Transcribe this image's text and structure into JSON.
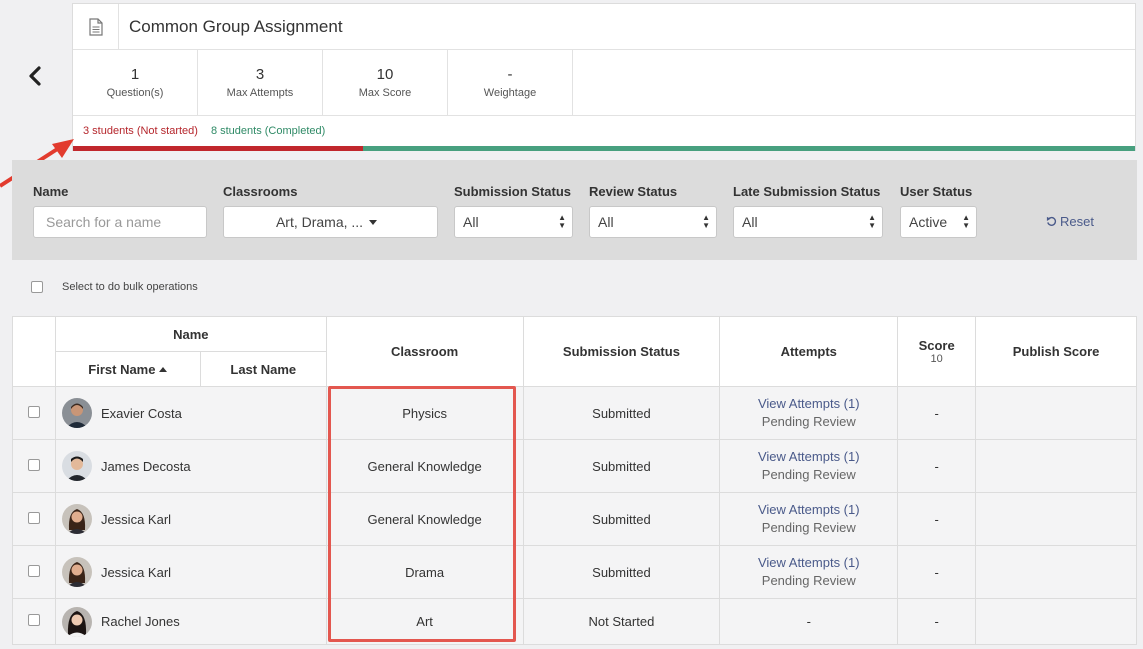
{
  "assignment": {
    "title": "Common Group Assignment",
    "stats": [
      {
        "value": "1",
        "label": "Question(s)"
      },
      {
        "value": "3",
        "label": "Max Attempts"
      },
      {
        "value": "10",
        "label": "Max Score"
      },
      {
        "value": "-",
        "label": "Weightage"
      }
    ],
    "progress": {
      "not_started_text": "3 students (Not started)",
      "completed_text": "8 students (Completed)",
      "not_started_fraction": 0.273,
      "not_started_color": "#c1272d",
      "completed_color": "#48a07f"
    }
  },
  "filters": {
    "name_label": "Name",
    "name_placeholder": "Search for a name",
    "classrooms_label": "Classrooms",
    "classrooms_value": "Art, Drama, ...",
    "submission_label": "Submission Status",
    "submission_value": "All",
    "review_label": "Review Status",
    "review_value": "All",
    "late_label": "Late Submission Status",
    "late_value": "All",
    "user_label": "User Status",
    "user_value": "Active",
    "reset_label": "Reset"
  },
  "bulk": {
    "label": "Select to do bulk operations"
  },
  "table": {
    "headers": {
      "name": "Name",
      "first_name": "First Name",
      "last_name": "Last Name",
      "classroom": "Classroom",
      "submission_status": "Submission Status",
      "attempts": "Attempts",
      "score": "Score",
      "score_max": "10",
      "publish_score": "Publish Score"
    },
    "rows": [
      {
        "name": "Exavier Costa",
        "classroom": "Physics",
        "status": "Submitted",
        "attempts_link": "View Attempts (1)",
        "attempts_note": "Pending Review",
        "score": "-"
      },
      {
        "name": "James Decosta",
        "classroom": "General Knowledge",
        "status": "Submitted",
        "attempts_link": "View Attempts (1)",
        "attempts_note": "Pending Review",
        "score": "-"
      },
      {
        "name": "Jessica Karl",
        "classroom": "General Knowledge",
        "status": "Submitted",
        "attempts_link": "View Attempts (1)",
        "attempts_note": "Pending Review",
        "score": "-"
      },
      {
        "name": "Jessica Karl",
        "classroom": "Drama",
        "status": "Submitted",
        "attempts_link": "View Attempts (1)",
        "attempts_note": "Pending Review",
        "score": "-"
      },
      {
        "name": "Rachel Jones",
        "classroom": "Art",
        "status": "Not Started",
        "attempts_text": "-",
        "score": "-"
      }
    ]
  },
  "colors": {
    "highlight_border": "#e3574f",
    "submitted": "#3a8a67",
    "not_started": "#a8262a",
    "link": "#4a5a8a"
  }
}
